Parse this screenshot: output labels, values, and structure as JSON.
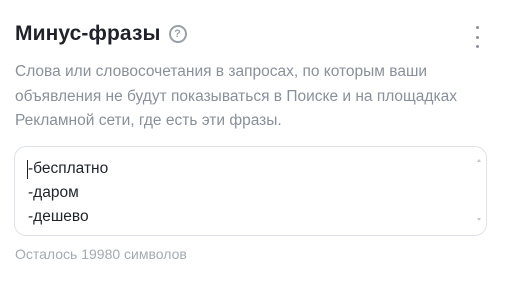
{
  "section": {
    "title": "Минус-фразы",
    "help_icon_glyph": "?",
    "description": "Слова или словосочетания в запросах, по которым ваши объявления не будут показываться в Поиске и на площадках Рекламной сети, где есть эти фразы."
  },
  "textarea": {
    "lines": [
      "-бесплатно",
      "-даром",
      "-дешево"
    ]
  },
  "counter": "Осталось 19980 символов",
  "icons": {
    "help": "question-circle-icon",
    "more": "more-vertical-icon"
  },
  "colors": {
    "title": "#1f2329",
    "muted": "#8a9099",
    "border": "#dfe2e6"
  }
}
